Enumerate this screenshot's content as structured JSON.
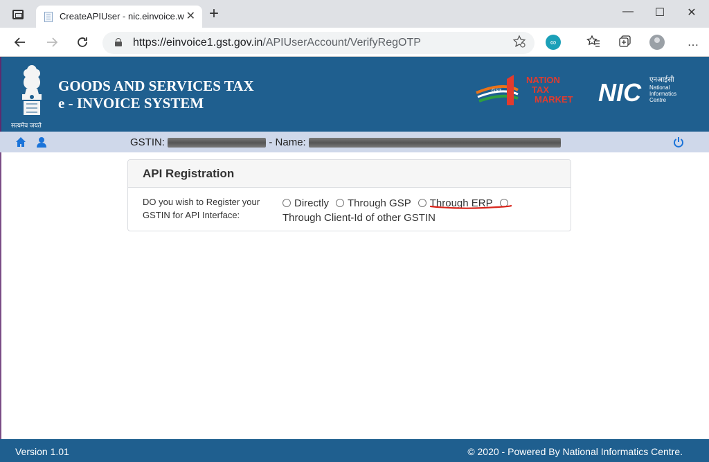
{
  "browser": {
    "tab_title": "CreateAPIUser - nic.einvoice.web",
    "url_host": "https://einvoice1.gst.gov.in",
    "url_path": "/APIUserAccount/VerifyRegOTP",
    "icons": [
      "back-icon",
      "forward-icon",
      "refresh-icon",
      "lock-icon",
      "favorite-star-icon",
      "extension-icon",
      "favorites-icon",
      "collections-icon",
      "profile-icon"
    ]
  },
  "header": {
    "title_line1": "GOODS AND SERVICES TAX",
    "title_line2": "e - INVOICE SYSTEM",
    "emblem_caption": "सत्यमेव जयते",
    "ont_logo_text": [
      "NATION",
      "TAX",
      "MARKET"
    ],
    "ont_badge": "GST",
    "nic_hindi": "एनआईसी",
    "nic_text": "NIC",
    "nic_caption": [
      "National",
      "Informatics",
      "Centre"
    ],
    "colors": {
      "header_bg": "#1f5f8f",
      "userbar_bg": "#cfd8ea"
    }
  },
  "userbar": {
    "gstin_label": "GSTIN:",
    "name_label": "- Name:"
  },
  "card": {
    "title": "API Registration",
    "question": "DO you wish to Register your GSTIN for API Interface:",
    "options": [
      "Directly",
      "Through GSP",
      "Through ERP",
      "Through Client-Id of other GSTIN"
    ]
  },
  "footer": {
    "version": "Version 1.01",
    "copyright": "© 2020 - Powered By National Informatics Centre."
  }
}
